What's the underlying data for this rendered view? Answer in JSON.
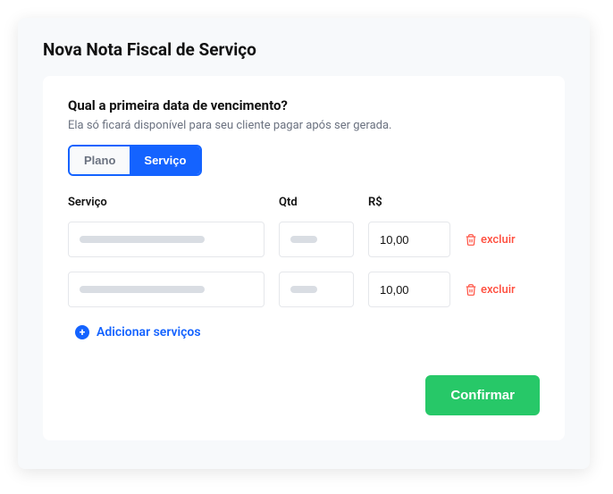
{
  "page": {
    "title": "Nova Nota Fiscal de Serviço"
  },
  "section": {
    "heading": "Qual a primeira data de vencimento?",
    "subtitle": "Ela só ficará disponível para seu cliente pagar após ser gerada."
  },
  "tabs": {
    "plano": "Plano",
    "servico": "Serviço"
  },
  "table": {
    "headers": {
      "service": "Serviço",
      "qty": "Qtd",
      "price": "R$"
    },
    "rows": [
      {
        "service": "",
        "qty": "",
        "price": "10,00",
        "delete": "excluir"
      },
      {
        "service": "",
        "qty": "",
        "price": "10,00",
        "delete": "excluir"
      }
    ]
  },
  "actions": {
    "add": "Adicionar serviços",
    "confirm": "Confirmar"
  }
}
